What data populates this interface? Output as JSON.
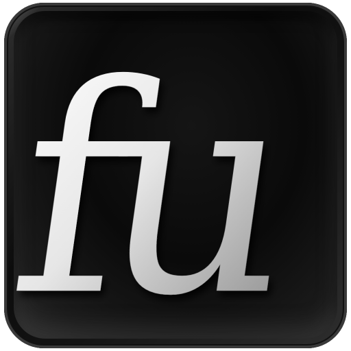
{
  "app_icon": {
    "logo_text": "fu",
    "background_color": "#0d0d0d",
    "letter_color_light": "#ffffff",
    "letter_color_dark": "#9a9a9a"
  }
}
